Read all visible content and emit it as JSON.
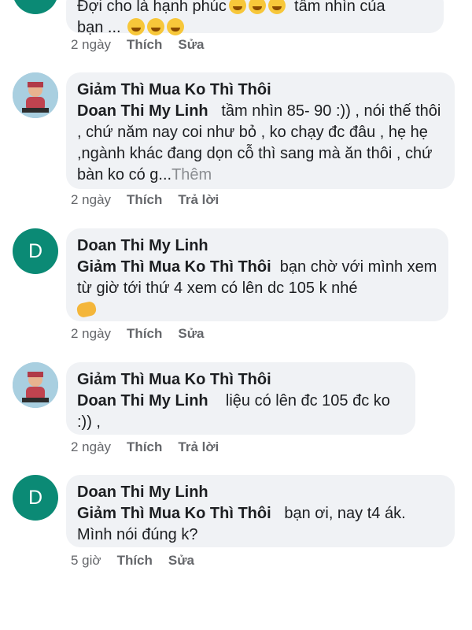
{
  "comments": [
    {
      "text_line1": "Đợi cho là hạnh phúc",
      "text_tail1": "tầm nhìn của",
      "text_line2": "bạn ...",
      "time": "2 ngày",
      "like": "Thích",
      "action": "Sửa"
    },
    {
      "author": "Giảm Thì Mua Ko Thì Thôi",
      "mention": "Doan Thi My Linh",
      "text": "tầm nhìn 85- 90 :))  , nói thế thôi , chứ năm nay coi như bỏ , ko chạy đc đâu , hẹ hẹ  ,ngành khác đang dọn cỗ thì sang mà ăn thôi , chứ bàn ko có g...",
      "more": "Thêm",
      "time": "2 ngày",
      "like": "Thích",
      "action": "Trả lời"
    },
    {
      "author": "Doan Thi My Linh",
      "avatar_letter": "D",
      "mention": "Giảm Thì Mua Ko Thì Thôi",
      "text": "bạn chờ với mình xem từ giờ tới thứ 4 xem có lên dc 105 k nhé",
      "time": "2 ngày",
      "like": "Thích",
      "action": "Sửa"
    },
    {
      "author": "Giảm Thì Mua Ko Thì Thôi",
      "mention": "Doan Thi My Linh",
      "text": "liệu có lên đc 105 đc ko :)) ,",
      "time": "2 ngày",
      "like": "Thích",
      "action": "Trả lời"
    },
    {
      "author": "Doan Thi My Linh",
      "avatar_letter": "D",
      "mention": "Giảm Thì Mua Ko Thì Thôi",
      "text": "bạn ơi, nay t4 ák. Mình nói đúng k?",
      "time": "5 giờ",
      "like": "Thích",
      "action": "Sửa"
    }
  ],
  "colors": {
    "avatar_d": "#0b8a75",
    "bubble_bg": "#f0f2f5",
    "meta_text": "#65676b"
  }
}
